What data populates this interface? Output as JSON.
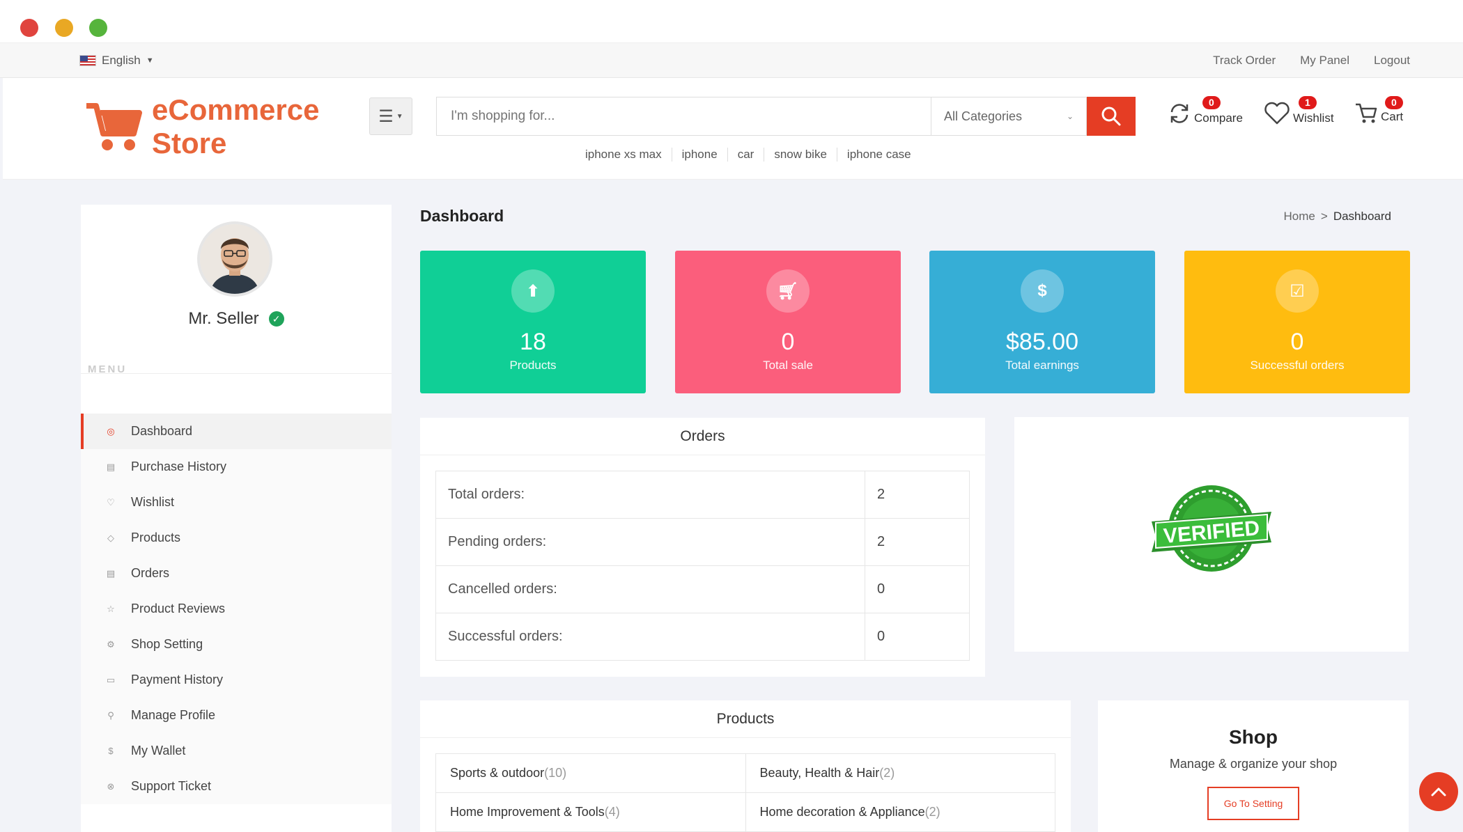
{
  "topbar": {
    "language": "English",
    "links": [
      "Track Order",
      "My Panel",
      "Logout"
    ]
  },
  "header": {
    "logo_line1": "eCommerce",
    "logo_line2": "Store",
    "search_placeholder": "I'm shopping for...",
    "category": "All Categories",
    "suggestions": [
      "iphone xs max",
      "iphone",
      "car",
      "snow bike",
      "iphone case"
    ],
    "compare": {
      "label": "Compare",
      "count": "0"
    },
    "wishlist": {
      "label": "Wishlist",
      "count": "1"
    },
    "cart": {
      "label": "Cart",
      "count": "0"
    }
  },
  "sidebar": {
    "seller_name": "Mr. Seller",
    "menu_label": "MENU",
    "items": [
      {
        "label": "Dashboard",
        "icon": "dashboard-icon"
      },
      {
        "label": "Purchase History",
        "icon": "file-icon"
      },
      {
        "label": "Wishlist",
        "icon": "heart-icon"
      },
      {
        "label": "Products",
        "icon": "diamond-icon"
      },
      {
        "label": "Orders",
        "icon": "file-icon"
      },
      {
        "label": "Product Reviews",
        "icon": "star-icon"
      },
      {
        "label": "Shop Setting",
        "icon": "gear-icon"
      },
      {
        "label": "Payment History",
        "icon": "card-icon"
      },
      {
        "label": "Manage Profile",
        "icon": "user-icon"
      },
      {
        "label": "My Wallet",
        "icon": "dollar-icon"
      },
      {
        "label": "Support Ticket",
        "icon": "support-icon"
      }
    ]
  },
  "main": {
    "title": "Dashboard",
    "breadcrumb": [
      "Home",
      ">",
      "Dashboard"
    ],
    "stats": [
      {
        "value": "18",
        "label": "Products",
        "color": "#10cf96"
      },
      {
        "value": "0",
        "label": "Total sale",
        "color": "#fb5e7c"
      },
      {
        "value": "$85.00",
        "label": "Total earnings",
        "color": "#36aed6"
      },
      {
        "value": "0",
        "label": "Successful orders",
        "color": "#ffbc0f"
      }
    ],
    "orders": {
      "title": "Orders",
      "rows": [
        {
          "label": "Total orders:",
          "value": "2"
        },
        {
          "label": "Pending orders:",
          "value": "2"
        },
        {
          "label": "Cancelled orders:",
          "value": "0"
        },
        {
          "label": "Successful orders:",
          "value": "0"
        }
      ]
    },
    "verified_stamp": "VERIFIED",
    "products": {
      "title": "Products",
      "categories": [
        {
          "name": "Sports & outdoor",
          "count": "(10)"
        },
        {
          "name": "Beauty, Health & Hair",
          "count": "(2)"
        },
        {
          "name": "Home Improvement & Tools",
          "count": "(4)"
        },
        {
          "name": "Home decoration & Appliance",
          "count": "(2)"
        }
      ]
    },
    "shop": {
      "title": "Shop",
      "subtitle": "Manage & organize your shop",
      "button": "Go To Setting"
    }
  },
  "colors": {
    "accent": "#e53d24",
    "logo": "#e8663a"
  }
}
